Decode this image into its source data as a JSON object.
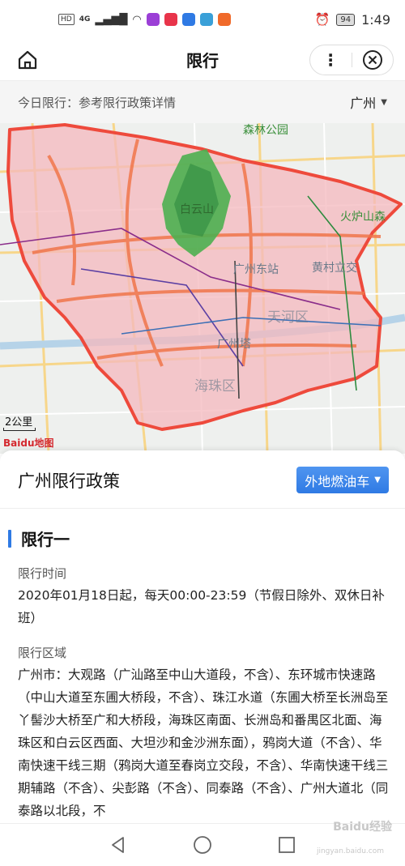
{
  "status_bar": {
    "hd_label": "HD",
    "network_label": "4G",
    "time": "1:49",
    "battery": "94"
  },
  "nav": {
    "title": "限行",
    "more_glyph": "⋮"
  },
  "info_row": {
    "text": "今日限行：参考限行政策详情",
    "city": "广州"
  },
  "map": {
    "labels": [
      "白云山",
      "广州东站",
      "广州塔",
      "海珠区",
      "火炉山森",
      "天河区",
      "黄村立交",
      "森林公园"
    ],
    "scale_label": "2公里",
    "logo_text": "Baidu地图",
    "colors": {
      "restriction_fill": "#f4b8bd",
      "restriction_border": "#ee4a3c",
      "park": "#4caf50"
    }
  },
  "policy": {
    "title": "广州限行政策",
    "car_type": "外地燃油车",
    "section_title": "限行一",
    "time_label": "限行时间",
    "time_text": "2020年01月18日起，每天00:00-23:59（节假日除外、双休日补班）",
    "area_label": "限行区域",
    "area_text": "广州市：大观路（广汕路至中山大道段，不含）、东环城市快速路（中山大道至东圃大桥段，不含）、珠江水道（东圃大桥至长洲岛至丫髻沙大桥至广和大桥段，海珠区南面、长洲岛和番禺区北面、海珠区和白云区西面、大坦沙和金沙洲东面），鸦岗大道（不含）、华南快速干线三期（鸦岗大道至春岗立交段，不含）、华南快速干线三期辅路（不含）、尖彭路（不含）、同泰路（不含）、广州大道北（同泰路以北段，不"
  },
  "watermark": {
    "text": "Baidu经验",
    "sub": "jingyan.baidu.com"
  }
}
